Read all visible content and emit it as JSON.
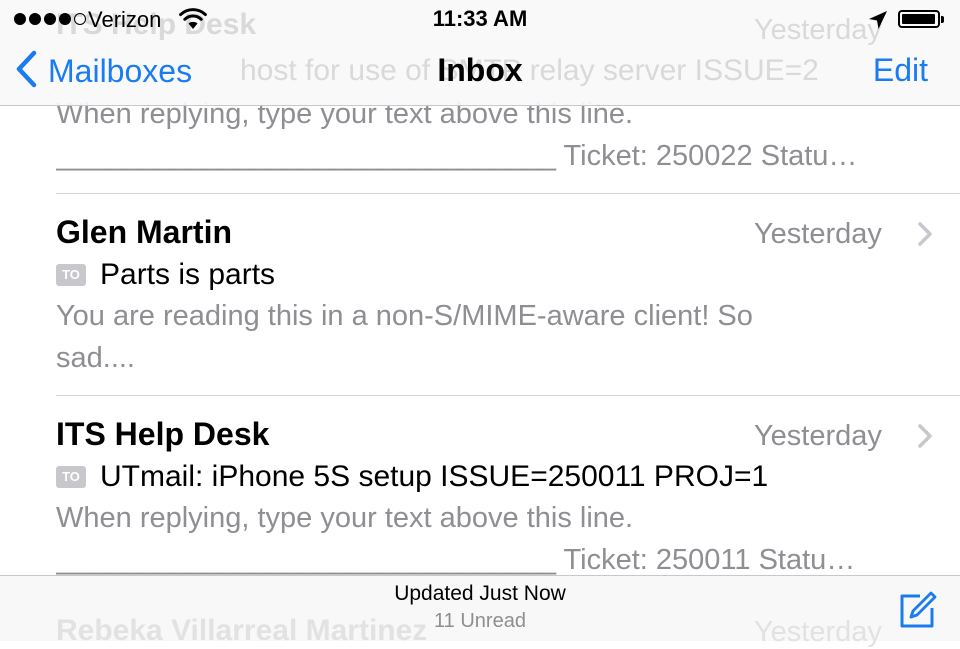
{
  "status_bar": {
    "carrier": "Verizon",
    "time": "11:33 AM",
    "signal_bars_filled": 4,
    "signal_bars_total": 5,
    "battery_level": 0.9
  },
  "nav": {
    "back_label": "Mailboxes",
    "title": "Inbox",
    "edit_label": "Edit",
    "behind_sender": "ITS Help Desk",
    "behind_date": "Yesterday",
    "behind_subject": "host for use of SMTP relay server ISSUE=2"
  },
  "messages": [
    {
      "preview_line1": "When replying, type your text above this line.",
      "preview_line2": "_______________________________ Ticket: 250022 Statu…"
    },
    {
      "sender": "Glen Martin",
      "date": "Yesterday",
      "badge": "TO",
      "subject": "Parts is parts",
      "preview_line1": "You are reading this in a non-S/MIME-aware client! So",
      "preview_line2": "sad...."
    },
    {
      "sender": "ITS Help Desk",
      "date": "Yesterday",
      "badge": "TO",
      "subject": "UTmail: iPhone 5S setup ISSUE=250011 PROJ=1",
      "preview_line1": "When replying, type your text above this line.",
      "preview_line2": "_______________________________ Ticket: 250011 Statu…"
    },
    {
      "sender": "Rebeka Villarreal Martinez",
      "date": "Yesterday"
    }
  ],
  "toolbar": {
    "status": "Updated Just Now",
    "unread": "11 Unread"
  },
  "colors": {
    "accent": "#1b7cf2",
    "secondary_text": "#8e8e93",
    "badge_bg": "#c7c7cc"
  },
  "icons": [
    "wifi-icon",
    "location-arrow-icon",
    "battery-icon",
    "chevron-left-icon",
    "chevron-right-icon",
    "compose-icon"
  ]
}
